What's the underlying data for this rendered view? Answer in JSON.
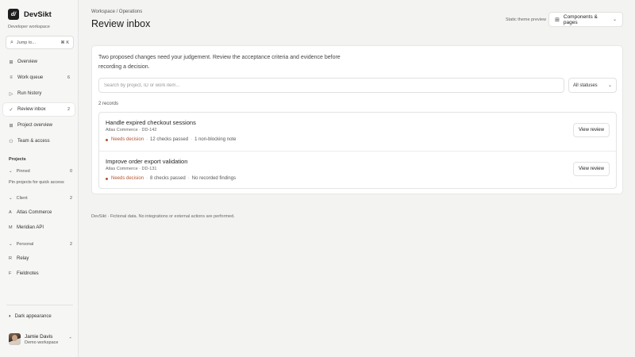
{
  "brand": {
    "logo_text": "d/",
    "name": "DevSikt",
    "subtitle": "Developer workspace"
  },
  "jump": {
    "placeholder": "Jump to...",
    "shortcut": "⌘ K"
  },
  "nav": [
    {
      "label": "Overview",
      "count": "",
      "icon": "grid-icon"
    },
    {
      "label": "Work queue",
      "count": "6",
      "icon": "queue-icon"
    },
    {
      "label": "Run history",
      "count": "",
      "icon": "play-icon"
    },
    {
      "label": "Review inbox",
      "count": "2",
      "icon": "check-icon"
    },
    {
      "label": "Project overview",
      "count": "",
      "icon": "grid-icon"
    },
    {
      "label": "Team & access",
      "count": "",
      "icon": "people-icon"
    }
  ],
  "projects": {
    "heading": "Projects",
    "pinned": {
      "label": "Pinned",
      "count": "0",
      "hint": "Pin projects for quick access"
    },
    "client": {
      "label": "Client",
      "count": "2",
      "items": [
        {
          "initial": "A",
          "name": "Atlas Commerce"
        },
        {
          "initial": "M",
          "name": "Meridian API"
        }
      ]
    },
    "personal": {
      "label": "Personal",
      "count": "2",
      "items": [
        {
          "initial": "R",
          "name": "Relay"
        },
        {
          "initial": "F",
          "name": "Fieldnotes"
        }
      ]
    }
  },
  "appearance": {
    "label": "Dark appearance"
  },
  "user": {
    "name": "Jamie Davis",
    "workspace": "Demo workspace"
  },
  "header": {
    "breadcrumb": "Workspace / Operations",
    "title": "Review inbox",
    "theme_note": "Static theme preview",
    "components_button": "Components & pages"
  },
  "inbox": {
    "intro": "Two proposed changes need your judgement. Review the acceptance criteria and evidence before recording a decision.",
    "search_placeholder": "Search by project, ID or work item...",
    "status_filter": "All statuses",
    "records": "2 records",
    "items": [
      {
        "title": "Handle expired checkout sessions",
        "meta": "Atlas Commerce · DD-142",
        "status": "Needs decision",
        "checks": "12 checks passed",
        "note": "1 non-blocking note",
        "action": "View review"
      },
      {
        "title": "Improve order export validation",
        "meta": "Atlas Commerce · DD-131",
        "status": "Needs decision",
        "checks": "8 checks passed",
        "note": "No recorded findings",
        "action": "View review"
      }
    ]
  },
  "footer": "DevSikt · Fictional data. No integrations or external actions are performed.",
  "colors": {
    "accent_warning": "#b4542c",
    "sidebar_bg": "#f6f6f5",
    "page_bg": "#f3f3f2"
  }
}
